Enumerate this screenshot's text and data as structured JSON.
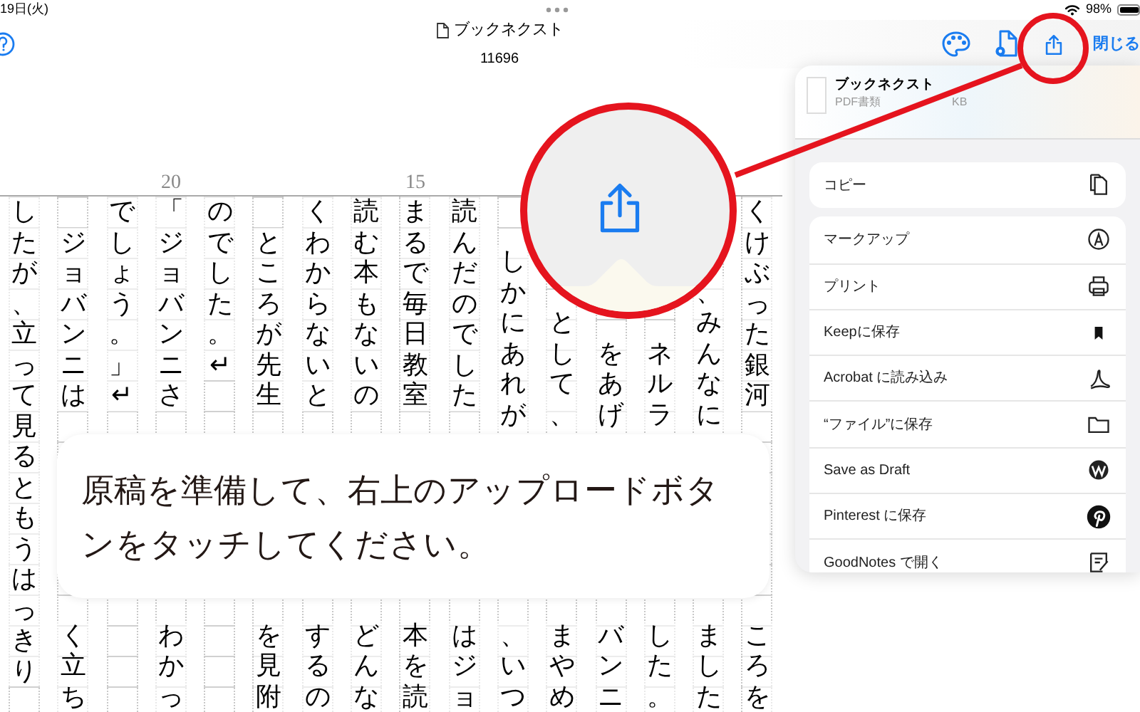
{
  "status_bar": {
    "date": "19日(火)",
    "battery": "98%"
  },
  "toolbar": {
    "title": "ブックネクスト",
    "subtitle": "11696",
    "close": "閉じる"
  },
  "manuscript": {
    "columns": [
      {
        "kind": "full",
        "top": "したが、立って見るともうはっきり"
      },
      {
        "kind": "indented",
        "top": "ジョバンニは",
        "bottom": "く立ち"
      },
      {
        "kind": "plain",
        "top": "でしょう。」↵"
      },
      {
        "kind": "plain",
        "top": "「ジョバンニさ",
        "bottom": "わかっ",
        "ruler_label": "20"
      },
      {
        "kind": "plain",
        "top": "のでした。↵"
      },
      {
        "kind": "indented",
        "top": "ところが先生",
        "bottom": "を見附"
      },
      {
        "kind": "plain",
        "top": "くわからないと",
        "bottom": "するの"
      },
      {
        "kind": "plain",
        "top": "読む本もないの",
        "bottom": "どんな"
      },
      {
        "kind": "plain",
        "top": "まるで毎日教室",
        "bottom": "本を読",
        "ruler_label": "15"
      },
      {
        "kind": "plain",
        "top": "読んだのでした",
        "bottom": "はジョ"
      },
      {
        "kind": "covered",
        "top": "しかにあれが",
        "bottom": "、いつ"
      },
      {
        "kind": "covered",
        "top": "として、",
        "bottom": "まやめ"
      },
      {
        "kind": "covered",
        "top": "をあげ",
        "bottom": "バンニ"
      },
      {
        "kind": "covered",
        "top": "ネルラ",
        "bottom": "した。"
      },
      {
        "kind": "covered",
        "top": "、みんなに",
        "bottom": "ました"
      },
      {
        "kind": "plain",
        "top": "くけぶった銀河",
        "bottom": "ころを"
      }
    ]
  },
  "share_sheet": {
    "file": {
      "name": "ブックネクスト",
      "type": "PDF書類",
      "size": "KB"
    },
    "groups": [
      {
        "actions": [
          {
            "label": "コピー",
            "kind": "copy"
          }
        ]
      },
      {
        "actions": [
          {
            "label": "マークアップ",
            "kind": "markup"
          },
          {
            "label": "プリント",
            "kind": "print"
          },
          {
            "label": "Keepに保存",
            "kind": "bookmark"
          },
          {
            "label": "Acrobat に読み込み",
            "kind": "acrobat"
          },
          {
            "label": "“ファイル”に保存",
            "kind": "folder"
          },
          {
            "label": "Save as Draft",
            "kind": "wordpress"
          },
          {
            "label": "Pinterest に保存",
            "kind": "pinterest"
          },
          {
            "label": "GoodNotes で開く",
            "kind": "goodnotes"
          }
        ]
      }
    ]
  },
  "callout": {
    "text": "原稿を準備して、右上のアップロードボタンをタッチしてください。"
  }
}
